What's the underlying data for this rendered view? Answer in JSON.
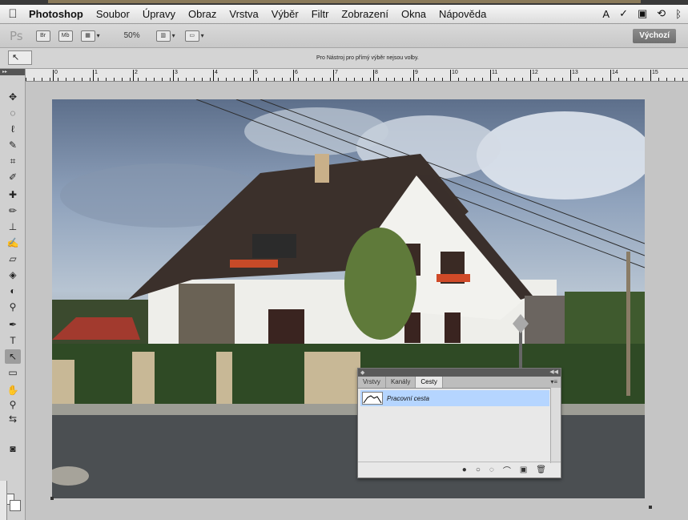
{
  "menubar": {
    "apple": "",
    "app": "Photoshop",
    "items": [
      "Soubor",
      "Úpravy",
      "Obraz",
      "Vrstva",
      "Výběr",
      "Filtr",
      "Zobrazení",
      "Okna",
      "Nápověda"
    ],
    "status_icons": [
      "adobe-icon",
      "checkmark-icon",
      "display-icon",
      "time-machine-icon",
      "bluetooth-icon"
    ]
  },
  "appbar": {
    "logo": "Ps",
    "zoom": "50%",
    "workspace": "Výchozí"
  },
  "options": {
    "tool_preset": "↖",
    "hint": "Pro Nástroj pro přímý výběr nejsou volby."
  },
  "ruler": {
    "ticks": [
      "0",
      "1",
      "2",
      "3",
      "4",
      "5",
      "6",
      "7",
      "8",
      "9",
      "10",
      "11",
      "12",
      "13",
      "14",
      "15"
    ]
  },
  "paths_panel": {
    "tabs": [
      "Vrstvy",
      "Kanály",
      "Cesty"
    ],
    "active_tab": "Cesty",
    "paths": [
      "Pracovní cesta"
    ],
    "footer_icons": [
      "fill-path-icon",
      "stroke-path-icon",
      "load-selection-icon",
      "make-work-path-icon",
      "new-path-icon",
      "delete-path-icon"
    ]
  },
  "colors": {
    "selection_row": "#b5d5ff",
    "workspace_button": "#7a7a7a"
  }
}
